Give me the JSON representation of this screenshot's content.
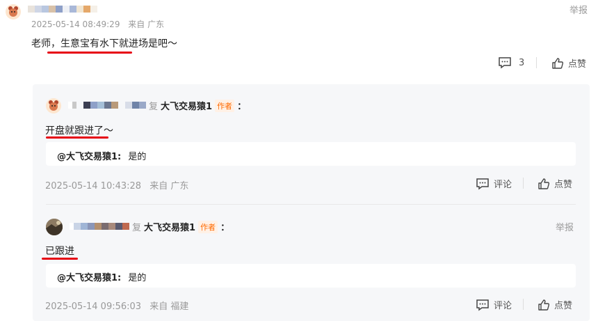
{
  "top_comment": {
    "username_masked": "",
    "timestamp": "2025-05-14 08:49:29",
    "location": "来自 广东",
    "text": "老师，生意宝有水下就进场是吧～",
    "report_label": "举报",
    "comment_count": "3",
    "like_label": "点赞"
  },
  "replies": [
    {
      "reply_prefix": "复",
      "reply_to": "大飞交易猿1",
      "author_tag": "作者",
      "colon": "：",
      "text": "开盘就跟进了～",
      "quote_author": "@大飞交易猿1:",
      "quote_text": "是的",
      "timestamp": "2025-05-14 10:43:28",
      "location": "来自 广东",
      "comment_label": "评论",
      "like_label": "点赞"
    },
    {
      "reply_prefix": "复",
      "reply_to": "大飞交易猿1",
      "author_tag": "作者",
      "colon": "：",
      "report_label": "举报",
      "text": "已跟进",
      "quote_author": "@大飞交易猿1:",
      "quote_text": "是的",
      "timestamp": "2025-05-14 09:56:03",
      "location": "来自 福建",
      "comment_label": "评论",
      "like_label": "点赞"
    }
  ],
  "colors": {
    "accent_red": "#e60012",
    "tag_orange": "#ff6a00",
    "panel_bg": "#f6f7f9"
  }
}
